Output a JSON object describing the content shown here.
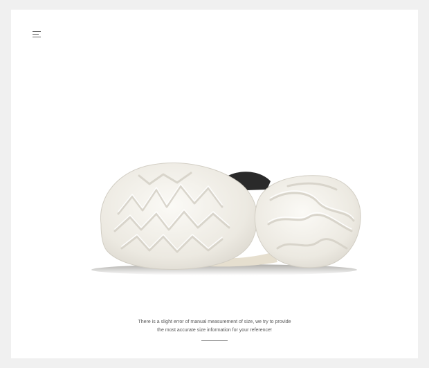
{
  "icons": {
    "menu": "menu-icon"
  },
  "caption": {
    "line1": "There is a slight error of manual measurement of size, we try to provide",
    "line2": "the most accurate size information for your reference!"
  },
  "colors": {
    "page_background": "#f0f0f0",
    "card_background": "#ffffff",
    "sole": "#f4f2ec",
    "caption_text": "#555555"
  }
}
